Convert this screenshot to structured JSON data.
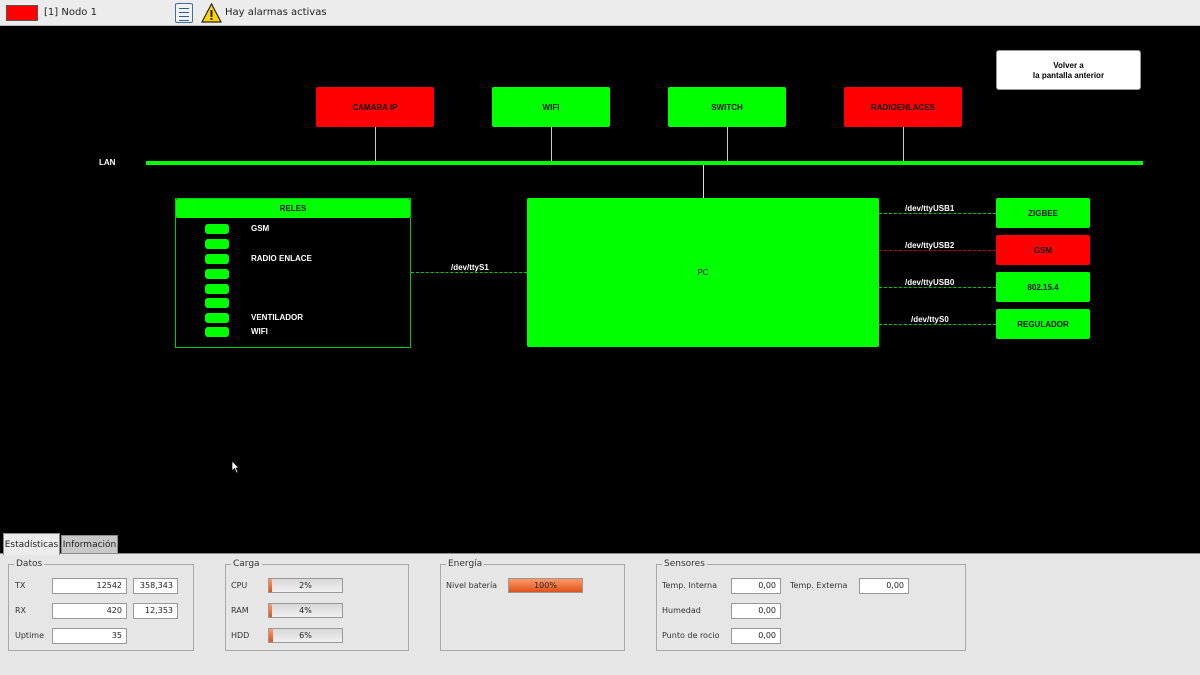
{
  "colors": {
    "ok": "#00ff00",
    "alarm": "#ff0000",
    "progress": "#e0521a"
  },
  "topbar": {
    "node_label": "[1] Nodo 1",
    "node_status_color": "#ff0000",
    "notes_icon": "notepad-icon",
    "warning_icon": "warning-triangle-icon",
    "alarm_text": "Hay alarmas activas"
  },
  "diagram": {
    "back_button": "Volver a\nla pantalla anterior",
    "lan_label": "LAN",
    "lan_devices": [
      {
        "label": "CAMARA IP",
        "status": "alarm"
      },
      {
        "label": "WIFI",
        "status": "ok"
      },
      {
        "label": "SWITCH",
        "status": "ok"
      },
      {
        "label": "RADIOENLACES",
        "status": "alarm"
      }
    ],
    "pc_label": "PC",
    "reles": {
      "title": "RELES",
      "items": [
        {
          "label": "GSM"
        },
        {
          "label": ""
        },
        {
          "label": "RADIO ENLACE"
        },
        {
          "label": ""
        },
        {
          "label": ""
        },
        {
          "label": ""
        },
        {
          "label": "VENTILADOR"
        },
        {
          "label": "WIFI"
        }
      ],
      "port": "/dev/ttyS1"
    },
    "serial_devices": [
      {
        "port": "/dev/ttyUSB1",
        "label": "ZIGBEE",
        "status": "ok"
      },
      {
        "port": "/dev/ttyUSB2",
        "label": "GSM",
        "status": "alarm"
      },
      {
        "port": "/dev/ttyUSB0",
        "label": "802.15.4",
        "status": "ok"
      },
      {
        "port": "/dev/ttyS0",
        "label": "REGULADOR",
        "status": "ok"
      }
    ]
  },
  "tabs": [
    "Estadísticas",
    "Información"
  ],
  "stats": {
    "datos": {
      "title": "Datos",
      "tx_label": "TX",
      "tx_value": "12542",
      "tx_value2": "358,343",
      "rx_label": "RX",
      "rx_value": "420",
      "rx_value2": "12,353",
      "uptime_label": "Uptime",
      "uptime_value": "35"
    },
    "carga": {
      "title": "Carga",
      "cpu_label": "CPU",
      "cpu_text": "2%",
      "cpu_fraction": 0.02,
      "ram_label": "RAM",
      "ram_text": "4%",
      "ram_fraction": 0.04,
      "hdd_label": "HDD",
      "hdd_text": "6%",
      "hdd_fraction": 0.06
    },
    "energia": {
      "title": "Energía",
      "battery_label": "Nivel batería",
      "battery_text": "100%",
      "battery_fraction": 1.0
    },
    "sensores": {
      "title": "Sensores",
      "temp_int_label": "Temp. Interna",
      "temp_int_value": "0,00",
      "temp_ext_label": "Temp. Externa",
      "temp_ext_value": "0,00",
      "humedad_label": "Humedad",
      "humedad_value": "0,00",
      "rocio_label": "Punto de rocio",
      "rocio_value": "0,00"
    }
  }
}
